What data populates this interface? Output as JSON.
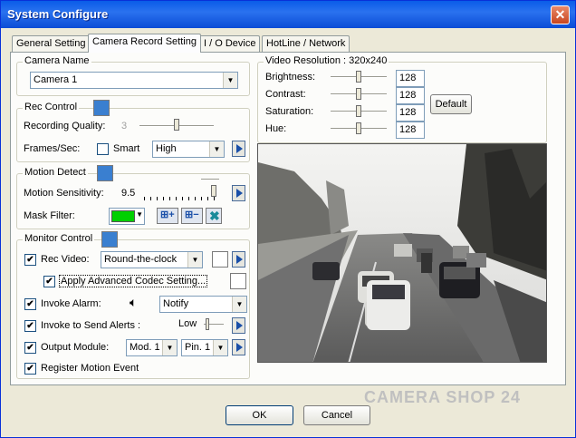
{
  "window": {
    "title": "System Configure"
  },
  "tabs": [
    "General Setting",
    "Camera Record Setting",
    "I / O Device",
    "HotLine / Network"
  ],
  "camera_name": {
    "legend": "Camera Name",
    "value": "Camera 1"
  },
  "rec_control": {
    "legend": "Rec Control",
    "quality_label": "Recording Quality:",
    "quality_value": "3",
    "fps_label": "Frames/Sec:",
    "smart_label": "Smart",
    "fps_value": "High"
  },
  "motion_detect": {
    "legend": "Motion Detect",
    "sensitivity_label": "Motion Sensitivity:",
    "sensitivity_value": "9.5",
    "mask_label": "Mask Filter:",
    "mask_color": "#00d000"
  },
  "monitor_control": {
    "legend": "Monitor Control",
    "rec_video_label": "Rec Video:",
    "rec_video_value": "Round-the-clock",
    "codec_label": "Apply Advanced Codec Setting...",
    "invoke_alarm_label": "Invoke Alarm:",
    "alarm_value": "Notify",
    "alerts_label": "Invoke to Send Alerts :",
    "alerts_level": "Low",
    "output_label": "Output Module:",
    "module_value": "Mod. 1",
    "pin_value": "Pin. 1",
    "register_label": "Register Motion Event"
  },
  "video": {
    "legend": "Video Resolution : 320x240",
    "brightness_label": "Brightness:",
    "brightness": "128",
    "contrast_label": "Contrast:",
    "contrast": "128",
    "saturation_label": "Saturation:",
    "saturation": "128",
    "hue_label": "Hue:",
    "hue": "128",
    "default_label": "Default"
  },
  "watermark": "CAMERA SHOP 24",
  "buttons": {
    "ok": "OK",
    "cancel": "Cancel"
  }
}
